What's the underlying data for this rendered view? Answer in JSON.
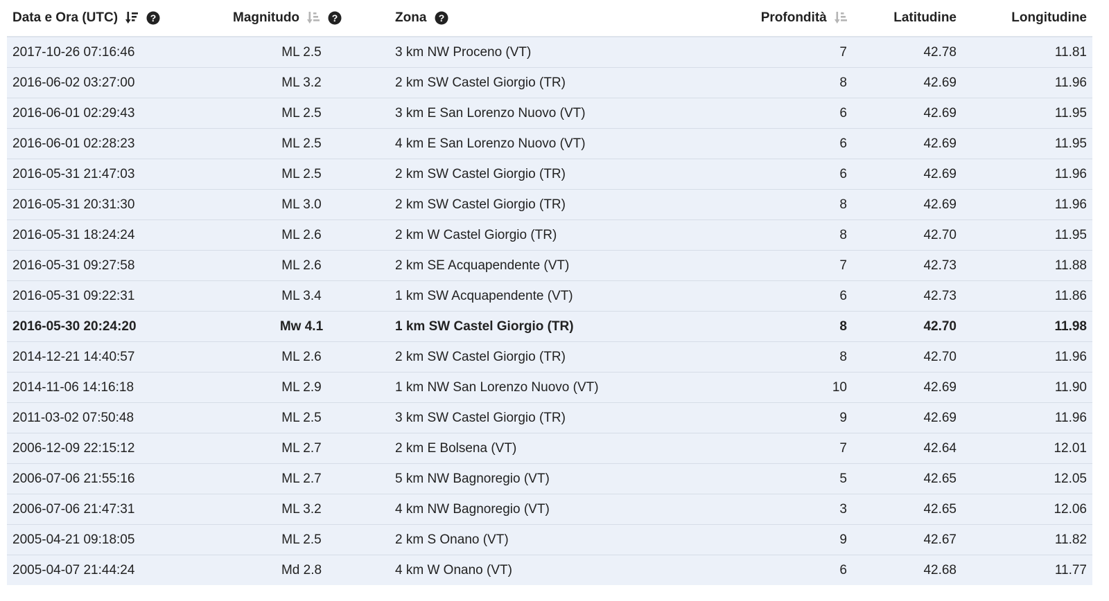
{
  "table": {
    "headers": {
      "date": "Data e Ora (UTC)",
      "magnitude": "Magnitudo",
      "zone": "Zona",
      "depth": "Profondità",
      "latitude": "Latitudine",
      "longitude": "Longitudine"
    },
    "sort": {
      "date": "active-desc",
      "magnitude": "inactive",
      "depth": "inactive"
    },
    "rows": [
      {
        "date": "2017-10-26 07:16:46",
        "mag": "ML 2.5",
        "zone": "3 km NW Proceno (VT)",
        "depth": "7",
        "lat": "42.78",
        "lon": "11.81",
        "highlighted": false
      },
      {
        "date": "2016-06-02 03:27:00",
        "mag": "ML 3.2",
        "zone": "2 km SW Castel Giorgio (TR)",
        "depth": "8",
        "lat": "42.69",
        "lon": "11.96",
        "highlighted": false
      },
      {
        "date": "2016-06-01 02:29:43",
        "mag": "ML 2.5",
        "zone": "3 km E San Lorenzo Nuovo (VT)",
        "depth": "6",
        "lat": "42.69",
        "lon": "11.95",
        "highlighted": false
      },
      {
        "date": "2016-06-01 02:28:23",
        "mag": "ML 2.5",
        "zone": "4 km E San Lorenzo Nuovo (VT)",
        "depth": "6",
        "lat": "42.69",
        "lon": "11.95",
        "highlighted": false
      },
      {
        "date": "2016-05-31 21:47:03",
        "mag": "ML 2.5",
        "zone": "2 km SW Castel Giorgio (TR)",
        "depth": "6",
        "lat": "42.69",
        "lon": "11.96",
        "highlighted": false
      },
      {
        "date": "2016-05-31 20:31:30",
        "mag": "ML 3.0",
        "zone": "2 km SW Castel Giorgio (TR)",
        "depth": "8",
        "lat": "42.69",
        "lon": "11.96",
        "highlighted": false
      },
      {
        "date": "2016-05-31 18:24:24",
        "mag": "ML 2.6",
        "zone": "2 km W Castel Giorgio (TR)",
        "depth": "8",
        "lat": "42.70",
        "lon": "11.95",
        "highlighted": false
      },
      {
        "date": "2016-05-31 09:27:58",
        "mag": "ML 2.6",
        "zone": "2 km SE Acquapendente (VT)",
        "depth": "7",
        "lat": "42.73",
        "lon": "11.88",
        "highlighted": false
      },
      {
        "date": "2016-05-31 09:22:31",
        "mag": "ML 3.4",
        "zone": "1 km SW Acquapendente (VT)",
        "depth": "6",
        "lat": "42.73",
        "lon": "11.86",
        "highlighted": false
      },
      {
        "date": "2016-05-30 20:24:20",
        "mag": "Mw 4.1",
        "zone": "1 km SW Castel Giorgio (TR)",
        "depth": "8",
        "lat": "42.70",
        "lon": "11.98",
        "highlighted": true
      },
      {
        "date": "2014-12-21 14:40:57",
        "mag": "ML 2.6",
        "zone": "2 km SW Castel Giorgio (TR)",
        "depth": "8",
        "lat": "42.70",
        "lon": "11.96",
        "highlighted": false
      },
      {
        "date": "2014-11-06 14:16:18",
        "mag": "ML 2.9",
        "zone": "1 km NW San Lorenzo Nuovo (VT)",
        "depth": "10",
        "lat": "42.69",
        "lon": "11.90",
        "highlighted": false
      },
      {
        "date": "2011-03-02 07:50:48",
        "mag": "ML 2.5",
        "zone": "3 km SW Castel Giorgio (TR)",
        "depth": "9",
        "lat": "42.69",
        "lon": "11.96",
        "highlighted": false
      },
      {
        "date": "2006-12-09 22:15:12",
        "mag": "ML 2.7",
        "zone": "2 km E Bolsena (VT)",
        "depth": "7",
        "lat": "42.64",
        "lon": "12.01",
        "highlighted": false
      },
      {
        "date": "2006-07-06 21:55:16",
        "mag": "ML 2.7",
        "zone": "5 km NW Bagnoregio (VT)",
        "depth": "5",
        "lat": "42.65",
        "lon": "12.05",
        "highlighted": false
      },
      {
        "date": "2006-07-06 21:47:31",
        "mag": "ML 3.2",
        "zone": "4 km NW Bagnoregio (VT)",
        "depth": "3",
        "lat": "42.65",
        "lon": "12.06",
        "highlighted": false
      },
      {
        "date": "2005-04-21 09:18:05",
        "mag": "ML 2.5",
        "zone": "2 km S Onano (VT)",
        "depth": "9",
        "lat": "42.67",
        "lon": "11.82",
        "highlighted": false
      },
      {
        "date": "2005-04-07 21:44:24",
        "mag": "Md 2.8",
        "zone": "4 km W Onano (VT)",
        "depth": "6",
        "lat": "42.68",
        "lon": "11.77",
        "highlighted": false
      }
    ]
  },
  "icons": {
    "sort_active": "sort-amount-desc-icon",
    "sort_inactive": "sort-amount-desc-icon",
    "help": "question-circle-icon"
  },
  "colors": {
    "row_background": "#ecf1f9",
    "row_border": "#d6dde7",
    "text": "#222222",
    "sort_inactive": "#b5b5b5"
  }
}
